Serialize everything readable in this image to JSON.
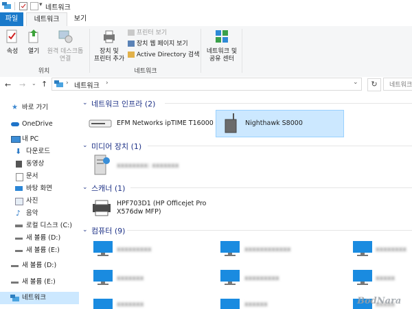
{
  "window": {
    "title": "네트워크"
  },
  "tabs": {
    "file": "파일",
    "network": "네트워크",
    "view": "보기"
  },
  "ribbon": {
    "location_group": {
      "label": "위치",
      "properties": "속성",
      "open": "열기",
      "remote_desktop": [
        "원격 데스크톱",
        "연결"
      ]
    },
    "network_group": {
      "label": "네트워크",
      "add_device": [
        "장치 및",
        "프린터 추가"
      ],
      "printer_view": "프린터 보기",
      "device_web": "장치 웹 페이지 보기",
      "active_directory": "Active Directory 검색"
    },
    "center_group": {
      "network_center": [
        "네트워크 및",
        "공유 센터"
      ]
    }
  },
  "address": {
    "path": "네트워크",
    "search_placeholder": "네트워크"
  },
  "sidebar": {
    "items": [
      {
        "label": "바로 가기",
        "icon": "star-icon"
      },
      {
        "label": "OneDrive",
        "icon": "cloud-icon"
      },
      {
        "label": "내 PC",
        "icon": "pc-icon"
      },
      {
        "label": "다운로드",
        "icon": "download-icon"
      },
      {
        "label": "동영상",
        "icon": "video-icon"
      },
      {
        "label": "문서",
        "icon": "document-icon"
      },
      {
        "label": "바탕 화면",
        "icon": "desktop-icon"
      },
      {
        "label": "사진",
        "icon": "picture-icon"
      },
      {
        "label": "음악",
        "icon": "music-icon"
      },
      {
        "label": "로컬 디스크 (C:)",
        "icon": "disk-icon"
      },
      {
        "label": "새 볼륨 (D:)",
        "icon": "drive-icon"
      },
      {
        "label": "새 볼륨 (E:)",
        "icon": "drive-icon"
      },
      {
        "label": "새 볼륨 (D:)",
        "icon": "drive-icon"
      },
      {
        "label": "새 볼륨 (E:)",
        "icon": "drive-icon"
      },
      {
        "label": "네트워크",
        "icon": "network-icon"
      }
    ]
  },
  "content": {
    "infra": {
      "title": "네트워크 인프라 (2)",
      "items": [
        "EFM Networks ipTIME T16000",
        "Nighthawk S8000"
      ]
    },
    "media": {
      "title": "미디어 장치 (1)",
      "items": [
        "xxxxxxxx: xxxxxxx"
      ]
    },
    "scanner": {
      "title": "스캐너 (1)",
      "items": [
        [
          "HPF703D1 (HP Officejet Pro",
          "X576dw MFP)"
        ]
      ]
    },
    "computers": {
      "title": "컴퓨터 (9)",
      "items": [
        "xxxxxxxxx",
        "xxxxxxxxxxxx",
        "xxxxxxxx",
        "xxxxxxx",
        "xxxxxxxxx",
        "xxxxx",
        "xxxxxxx",
        "xxxxxx",
        "xxxxx"
      ]
    }
  },
  "watermark": "BodNara",
  "colors": {
    "accent": "#1979ca",
    "selection": "#cce8ff",
    "group_title": "#1e3287"
  }
}
